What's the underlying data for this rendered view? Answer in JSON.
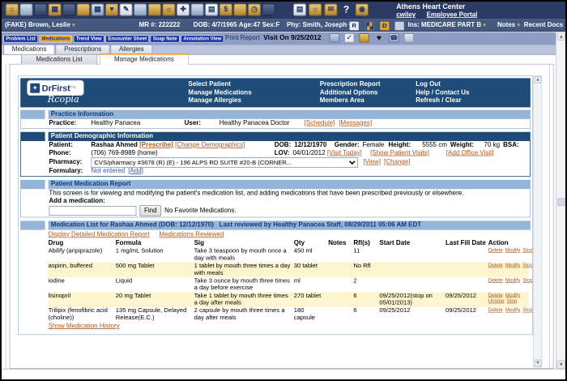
{
  "topbar": {
    "clinic_name": "Athens Heart Center",
    "links": [
      "cwiley",
      "Employee Portal"
    ],
    "icons": [
      "home-icon",
      "patient-icon",
      "physician-icon",
      "chart-icon",
      "imaging-icon",
      "cart-icon",
      "calendar-icon",
      "filter-icon",
      "orders-icon",
      "stethoscope-icon",
      "visit-icon",
      "alert-icon",
      "medications-icon",
      "immunization-icon",
      "document-icon",
      "billing-icon",
      "fax-icon",
      "clock-icon",
      "web-icon"
    ],
    "right_icons": [
      "print-icon",
      "settings-icon",
      "mail-icon",
      "help-icon",
      "logout-icon"
    ]
  },
  "patientbar": {
    "patient": "(FAKE) Brown, Leslie",
    "mr": "MR #: 222222",
    "dob": "DOB: 4/7/1965",
    "age": "Age:47",
    "sex": "Sex:F",
    "phy": "Phy: Smith, Joseph",
    "ins": "Ins: MEDICARE PART B",
    "notes": "Notes",
    "recent": "Recent Docs",
    "d_badge": "D"
  },
  "navbar": {
    "buttons": [
      {
        "label": "Problem List",
        "active": false
      },
      {
        "label": "Medications",
        "active": true
      },
      {
        "label": "Trend View",
        "active": false
      },
      {
        "label": "Encounter Sheet",
        "active": false
      },
      {
        "label": "Soap Note",
        "active": false
      },
      {
        "label": "Annotation View",
        "active": false
      }
    ],
    "print_report": "Print Report",
    "visit": "Visit On 9/25/2012",
    "icons": [
      "save-icon",
      "check-icon",
      "note-icon",
      "favorites-icon",
      "phone-icon",
      "team-icon"
    ]
  },
  "tabs1": [
    {
      "label": "Medications",
      "active": true
    },
    {
      "label": "Prescriptions",
      "active": false
    },
    {
      "label": "Allergies",
      "active": false
    }
  ],
  "tabs2": [
    {
      "label": "Medications List",
      "active": false
    },
    {
      "label": "Manage Medications",
      "active": true
    }
  ],
  "drfirst": {
    "logo_title": "DrFirst",
    "logo_sub": "Rcopia",
    "menus": [
      [
        "Select Patient",
        "Manage Medications",
        "Manage Allergies"
      ],
      [
        "Prescription Report",
        "Additional Options",
        "Members Area"
      ],
      [
        "Log Out",
        "Help / Contact Us",
        "Refresh / Clear"
      ]
    ],
    "practice": {
      "header": "Practice Information",
      "practice_label": "Practice:",
      "practice": "Healthy Panacea",
      "user_label": "User:",
      "user": "Healthy Panacea Doctor",
      "schedule": "[Schedule]",
      "messages": "[Messages]"
    },
    "demo": {
      "header": "Patient Demographic Information",
      "patient_label": "Patient:",
      "patient": "Rashaa Ahmed",
      "prescribe": "[Prescribe]",
      "change_demo": "[Change Demographics]",
      "dob_label": "DOB:",
      "dob": "12/12/1970",
      "gender_label": "Gender:",
      "gender": "Female",
      "height_label": "Height:",
      "height": "5555 cm",
      "weight_label": "Weight:",
      "weight": "70 kg",
      "bsa_label": "BSA:",
      "phone_label": "Phone:",
      "phone": "(706) 769-8989 (home)",
      "lov_label": "LOV:",
      "lov": "04/01/2012",
      "visit_today": "[Visit Today]",
      "show_visits": "[Show Patient Visits]",
      "add_visit": "[Add Office Visit]",
      "pharmacy_label": "Pharmacy:",
      "pharmacy": "CVS/pharmacy #3678 (R) (E) - 196 ALPS RD SUITE #20-B (CORNER...",
      "view": "[View]",
      "change": "[Change]",
      "formulary_label": "Formulary:",
      "formulary": "Not entered",
      "add": "[Add]"
    },
    "medreport": {
      "header": "Patient Medication Report",
      "description": "This screen is for viewing and modifying the patient's medication list, and adding medications that have been prescribed previously or elsewhere.",
      "add_label": "Add a medication:",
      "find": "Find",
      "no_fav": "No Favorite Medications."
    },
    "medlist": {
      "header": "Medication List for Rashaa Ahmed (DOB: 12/12/1970)   Last reviewed by Healthy Panacea Staff, 08/29/2011 05:06 AM EDT",
      "link_report": "Display Detailed Medication Report",
      "link_reviewed": "Medications Reviewed",
      "columns": [
        "Drug",
        "Formula",
        "Sig",
        "Qty",
        "Notes",
        "Rfl(s)",
        "Start Date",
        "Last Fill Date",
        "Action"
      ],
      "rows": [
        {
          "drug": "Abilify (aripiprazole)",
          "formula": "1 mg/mL Solution",
          "sig": "Take 3 teaspoon by mouth once a day with meals",
          "qty": "450 ml",
          "notes": "",
          "rf": "11",
          "start": "",
          "lastfill": "",
          "actions": [
            "Delete",
            "Modify",
            "Stop"
          ],
          "highlight": false
        },
        {
          "drug": "aspirin, buffered",
          "formula": "500 mg Tablet",
          "sig": "1 tablet by mouth three times a day with meals",
          "qty": "30 tablet",
          "notes": "",
          "rf": "No Rfl",
          "start": "",
          "lastfill": "",
          "actions": [
            "Delete",
            "Modify",
            "Stop"
          ],
          "highlight": true
        },
        {
          "drug": "iodine",
          "formula": "Liquid",
          "sig": "Take 3 ounce by mouth three times a day before exercise",
          "qty": "ml",
          "notes": "",
          "rf": "2",
          "start": "",
          "lastfill": "",
          "actions": [
            "Delete",
            "Modify",
            "Stop"
          ],
          "highlight": false
        },
        {
          "drug": "lisinopril",
          "formula": "20 mg Tablet",
          "sig": "Take 1 tablet by mouth three times a day after meals",
          "qty": "270 tablet",
          "notes": "",
          "rf": "6",
          "start": "09/25/2012(stop on 05/01/2013)",
          "lastfill": "09/25/2012",
          "actions": [
            "Delete",
            "Modify",
            "Unstop",
            "Stop"
          ],
          "highlight": true
        },
        {
          "drug": "Trilipix (fenofibric acid (choline))",
          "formula": "135 mg Capsule, Delayed Release(E.C.)",
          "sig": "2 capsule by mouth three times a day after meals",
          "qty": "180 capsule",
          "notes": "",
          "rf": "6",
          "start": "09/25/2012",
          "lastfill": "09/25/2012",
          "actions": [
            "Delete",
            "Modify",
            "Stop"
          ],
          "highlight": false
        }
      ],
      "history_link": "Show Medication History"
    }
  }
}
